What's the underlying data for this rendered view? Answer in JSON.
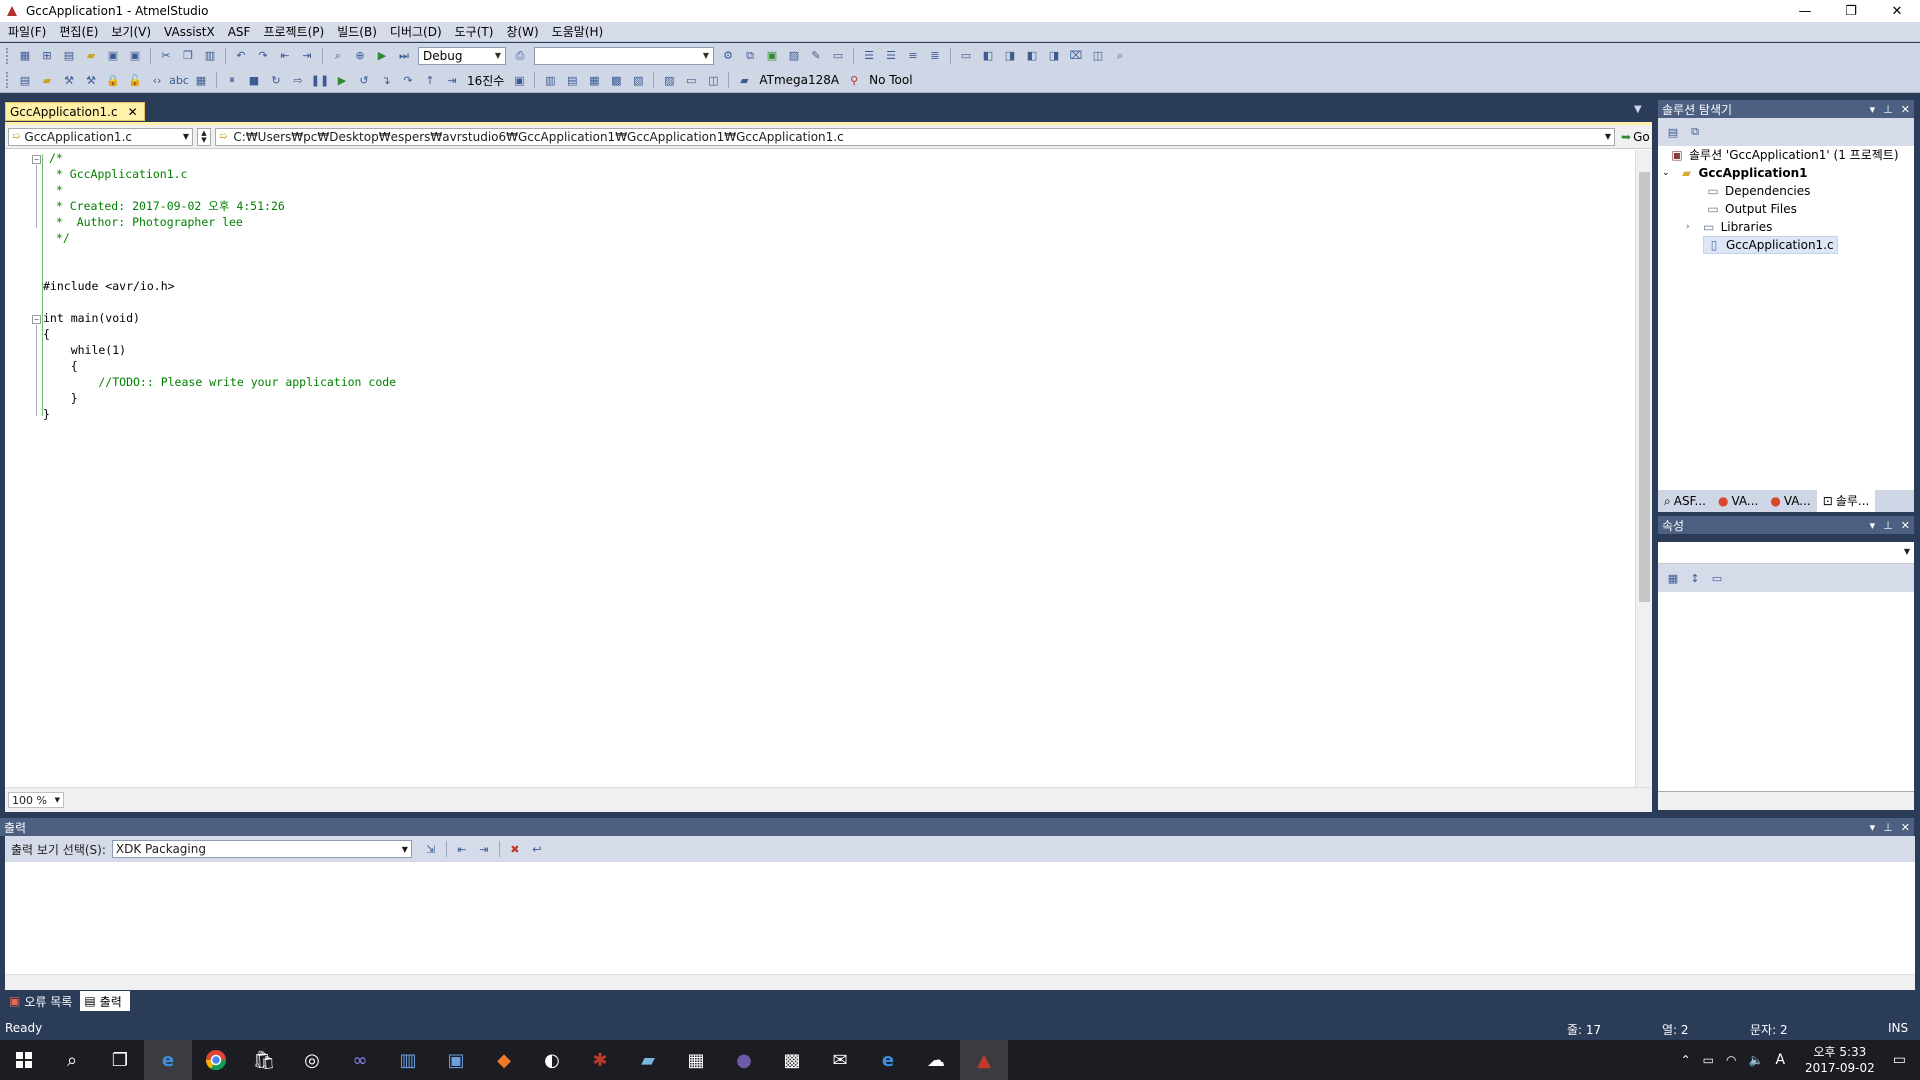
{
  "window": {
    "title": "GccApplication1 - AtmelStudio",
    "minimize": "—",
    "maximize": "❐",
    "close": "✕"
  },
  "menu": [
    "파일(F)",
    "편집(E)",
    "보기(V)",
    "VAssistX",
    "ASF",
    "프로젝트(P)",
    "빌드(B)",
    "디버그(D)",
    "도구(T)",
    "창(W)",
    "도움말(H)"
  ],
  "toolbar": {
    "config": "Debug",
    "radix": "16진수",
    "device": "ATmega128A",
    "tool": "No Tool"
  },
  "editor": {
    "tab_label": "GccApplication1.c",
    "tab_close": "✕",
    "file_combo": "GccApplication1.c",
    "path": "C:₩Users₩pc₩Desktop₩espers₩avrstudio6₩GccApplication1₩GccApplication1₩GccApplication1.c",
    "go_label": "Go",
    "zoom": "100 %",
    "code": [
      "/*",
      " * GccApplication1.c",
      " *",
      " * Created: 2017-09-02 오후 4:51:26",
      " *  Author: Photographer lee",
      " */",
      "",
      "",
      "#include <avr/io.h>",
      "",
      "int main(void)",
      "{",
      "    while(1)",
      "    {",
      "        //TODO:: Please write your application code",
      "    }",
      "}"
    ]
  },
  "solution_explorer": {
    "title": "솔루션 탐색기",
    "solution": "솔루션 'GccApplication1' (1 프로젝트)",
    "project": "GccApplication1",
    "items": [
      "Dependencies",
      "Output Files",
      "Libraries",
      "GccApplication1.c"
    ]
  },
  "panel_tabs": [
    "ASF...",
    "VA...",
    "VA...",
    "솔루..."
  ],
  "properties": {
    "title": "속성"
  },
  "output": {
    "title": "출력",
    "select_label": "출력 보기 선택(S):",
    "select_value": "XDK Packaging"
  },
  "bottom_tabs": [
    "오류 목록",
    "출력"
  ],
  "status": {
    "ready": "Ready",
    "line": "줄: 17",
    "col": "열: 2",
    "char": "문자: 2",
    "mode": "INS"
  },
  "taskbar": {
    "time": "오후 5:33",
    "date": "2017-09-02",
    "ime": "A"
  },
  "colors": {
    "accent": "#2b3c59",
    "tab_active": "#fff1a8",
    "comment": "#008000"
  }
}
